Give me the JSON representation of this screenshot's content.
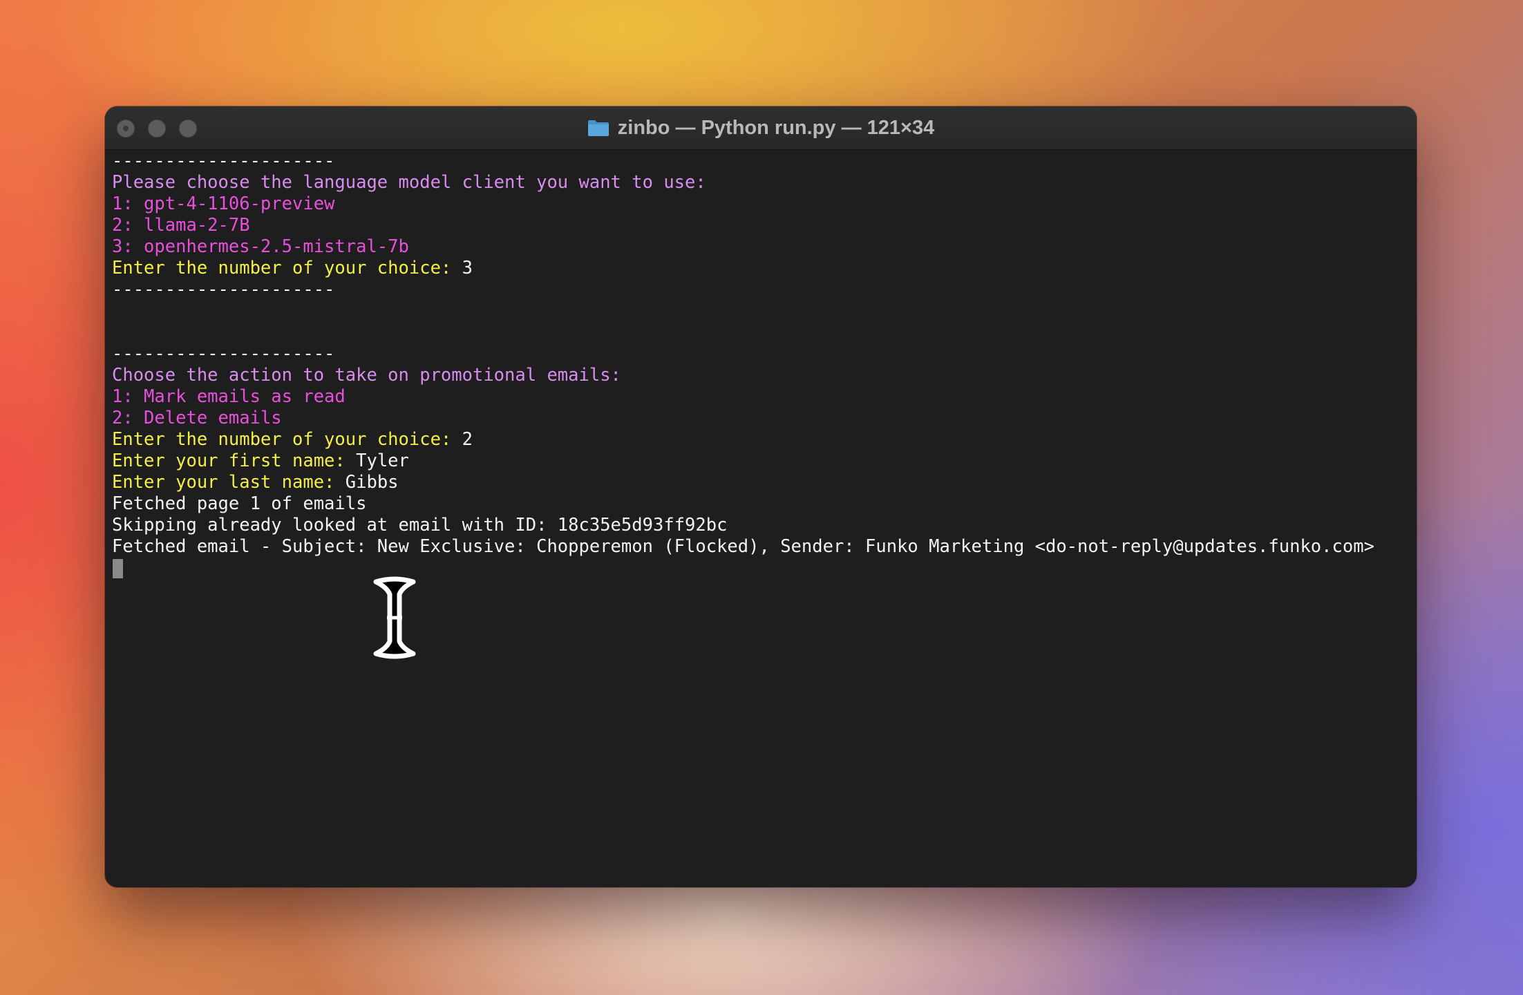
{
  "window": {
    "title": "zinbo — Python run.py — 121×34",
    "folder_icon": "folder-icon"
  },
  "colors": {
    "white": "#f2f2f2",
    "violet": "#d88cf0",
    "magenta": "#e84fdc",
    "yellow": "#f4ee4a"
  },
  "terminal": {
    "lines": [
      [
        {
          "text": "---------------------",
          "color": "white"
        }
      ],
      [
        {
          "text": "Please choose the language model client you want to use:",
          "color": "violet"
        }
      ],
      [
        {
          "text": "1: gpt-4-1106-preview",
          "color": "magenta"
        }
      ],
      [
        {
          "text": "2: llama-2-7B",
          "color": "magenta"
        }
      ],
      [
        {
          "text": "3: openhermes-2.5-mistral-7b",
          "color": "magenta"
        }
      ],
      [
        {
          "text": "Enter the number of your choice: ",
          "color": "yellow"
        },
        {
          "text": "3",
          "color": "white"
        }
      ],
      [
        {
          "text": "---------------------",
          "color": "white"
        }
      ],
      [],
      [],
      [
        {
          "text": "---------------------",
          "color": "white"
        }
      ],
      [
        {
          "text": "Choose the action to take on promotional emails:",
          "color": "violet"
        }
      ],
      [
        {
          "text": "1: Mark emails as read",
          "color": "magenta"
        }
      ],
      [
        {
          "text": "2: Delete emails",
          "color": "magenta"
        }
      ],
      [
        {
          "text": "Enter the number of your choice: ",
          "color": "yellow"
        },
        {
          "text": "2",
          "color": "white"
        }
      ],
      [
        {
          "text": "Enter your first name: ",
          "color": "yellow"
        },
        {
          "text": "Tyler",
          "color": "white"
        }
      ],
      [
        {
          "text": "Enter your last name: ",
          "color": "yellow"
        },
        {
          "text": "Gibbs",
          "color": "white"
        }
      ],
      [
        {
          "text": "Fetched page 1 of emails",
          "color": "white"
        }
      ],
      [
        {
          "text": "Skipping already looked at email with ID: 18c35e5d93ff92bc",
          "color": "white"
        }
      ],
      [
        {
          "text": "Fetched email - Subject: New Exclusive: Chopperemon (Flocked), Sender: Funko Marketing <do-not-reply@updates.funko.com>",
          "color": "white"
        }
      ]
    ]
  }
}
